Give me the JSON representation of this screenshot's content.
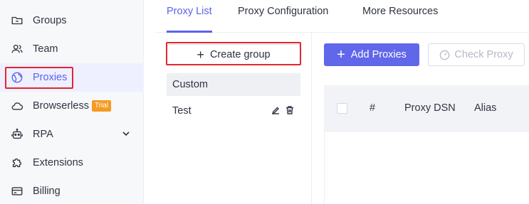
{
  "sidebar": {
    "items": [
      {
        "label": "Groups",
        "icon": "folder-icon"
      },
      {
        "label": "Team",
        "icon": "users-icon"
      },
      {
        "label": "Proxies",
        "icon": "globe-icon"
      },
      {
        "label": "Browserless",
        "icon": "cloud-icon",
        "badge": "Trial"
      },
      {
        "label": "RPA",
        "icon": "robot-icon"
      },
      {
        "label": "Extensions",
        "icon": "puzzle-icon"
      },
      {
        "label": "Billing",
        "icon": "credit-card-icon"
      }
    ],
    "active_color": "#5b63e6"
  },
  "tabs": [
    {
      "label": "Proxy List"
    },
    {
      "label": "Proxy Configuration"
    },
    {
      "label": "More Resources"
    }
  ],
  "groups": {
    "create_label": "Create group",
    "items": [
      {
        "label": "Custom"
      },
      {
        "label": "Test"
      }
    ]
  },
  "toolbar": {
    "add_label": "Add Proxies",
    "check_label": "Check Proxy"
  },
  "table": {
    "columns": [
      "#",
      "Proxy DSN",
      "Alias"
    ]
  },
  "colors": {
    "accent": "#6167ea",
    "highlight": "#e3262e",
    "badge": "#f59a23"
  }
}
